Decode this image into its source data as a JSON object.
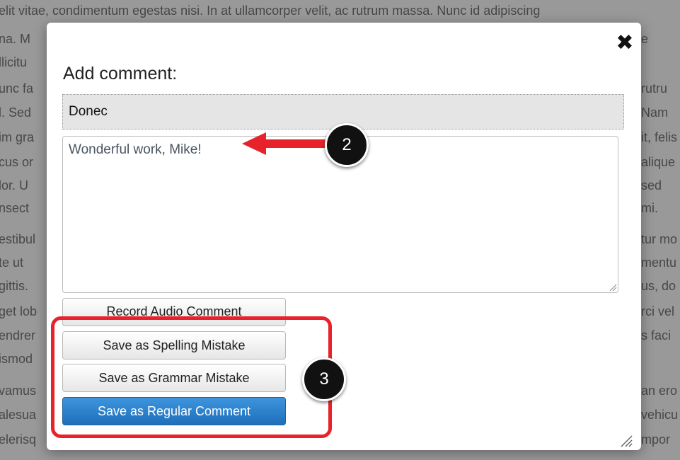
{
  "background": {
    "lines_left": [
      "elit vitae, condimentum egestas nisi. In at ullamcorper velit, ac rutrum massa. Nunc id adipiscing",
      "na. M",
      "llicitu",
      "unc fa",
      "l. Sed",
      "im gra",
      "cus or",
      "lor. U",
      "nsect",
      "estibul",
      "te ut",
      "gittis.",
      "get lob",
      "endrer",
      "ismod",
      "vamus",
      "alesua",
      "elerisq"
    ],
    "lines_right": [
      "",
      "e",
      "",
      "rutru",
      "Nam",
      "it, felis",
      "alique",
      "sed",
      "mi.",
      "tur mo",
      "mentu",
      "us, do",
      "rci vel",
      "s faci",
      "",
      "an ero",
      "vehicu",
      "mpor"
    ]
  },
  "modal": {
    "close_icon": "✖",
    "title": "Add comment:",
    "subject": "Donec",
    "comment_text": "Wonderful work, Mike!",
    "buttons": {
      "record_audio": "Record Audio Comment",
      "spelling": "Save as Spelling Mistake",
      "grammar": "Save as Grammar Mistake",
      "regular": "Save as Regular Comment"
    }
  },
  "annotations": {
    "marker_2": "2",
    "marker_3": "3",
    "highlight_color": "#e8222a",
    "arrow_color": "#e8222a"
  },
  "colors": {
    "primary_button": "#2a7fc9",
    "overlay": "#9b9b9b"
  }
}
